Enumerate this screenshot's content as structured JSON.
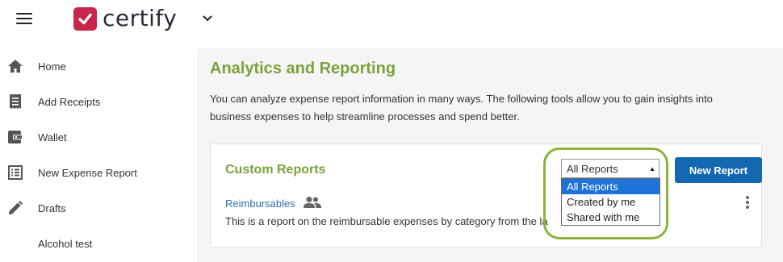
{
  "app": {
    "logo_text": "certify"
  },
  "sidebar": {
    "items": [
      {
        "label": "Home",
        "icon": "home-icon"
      },
      {
        "label": "Add Receipts",
        "icon": "receipt-icon"
      },
      {
        "label": "Wallet",
        "icon": "wallet-icon"
      },
      {
        "label": "New Expense Report",
        "icon": "report-list-icon"
      },
      {
        "label": "Drafts",
        "icon": "pencil-icon"
      },
      {
        "label": "Alcohol test",
        "icon": ""
      }
    ]
  },
  "main": {
    "title": "Analytics and Reporting",
    "intro_line1": "You can analyze expense report information in many ways. The following tools allow you to gain insights into",
    "intro_line2": "business expenses to help streamline processes and spend better."
  },
  "custom_reports": {
    "title": "Custom Reports",
    "new_report_label": "New Report",
    "filter": {
      "selected": "All Reports",
      "options": [
        "All Reports",
        "Created by me",
        "Shared with me"
      ]
    },
    "reports": [
      {
        "name": "Reimbursables",
        "description": "This is a report on the reimbursable expenses by category from the la"
      }
    ]
  },
  "colors": {
    "brand": "#c8264a",
    "accent_green": "#7aa33a",
    "primary_blue": "#1468b0",
    "link_blue": "#2f6fb2",
    "highlight_ring": "#8bb43c"
  }
}
